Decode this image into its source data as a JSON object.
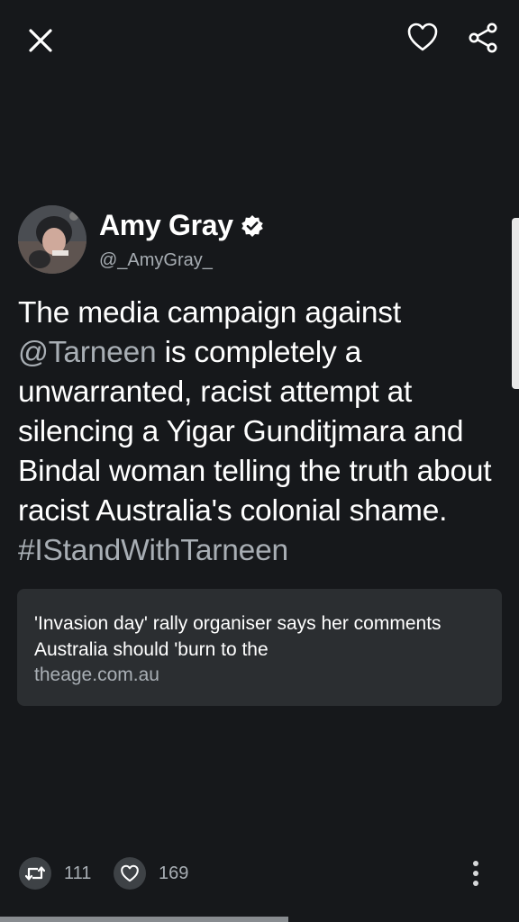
{
  "topbar": {
    "close_icon": "close-icon",
    "like_icon": "heart-outline-icon",
    "share_icon": "share-icon"
  },
  "author": {
    "name": "Amy Gray",
    "handle": "@_AmyGray_",
    "verified": true
  },
  "tweet": {
    "segments": [
      {
        "text": "The media campaign against ",
        "link": false
      },
      {
        "text": "@Tarneen",
        "link": true
      },
      {
        "text": " is completely a unwarranted, racist attempt at silencing a Yigar Gunditjmara and Bindal woman telling the truth about racist Australia's colonial shame. ",
        "link": false
      },
      {
        "text": "#IStandWithTarneen",
        "link": true
      }
    ]
  },
  "card": {
    "title": "'Invasion day' rally organiser says her comments Australia should 'burn to the",
    "domain": "theage.com.au"
  },
  "actions": {
    "retweet_count": "111",
    "like_count": "169"
  },
  "colors": {
    "background": "#16181b",
    "link": "#a8aeb4",
    "card": "#2b2e31"
  }
}
